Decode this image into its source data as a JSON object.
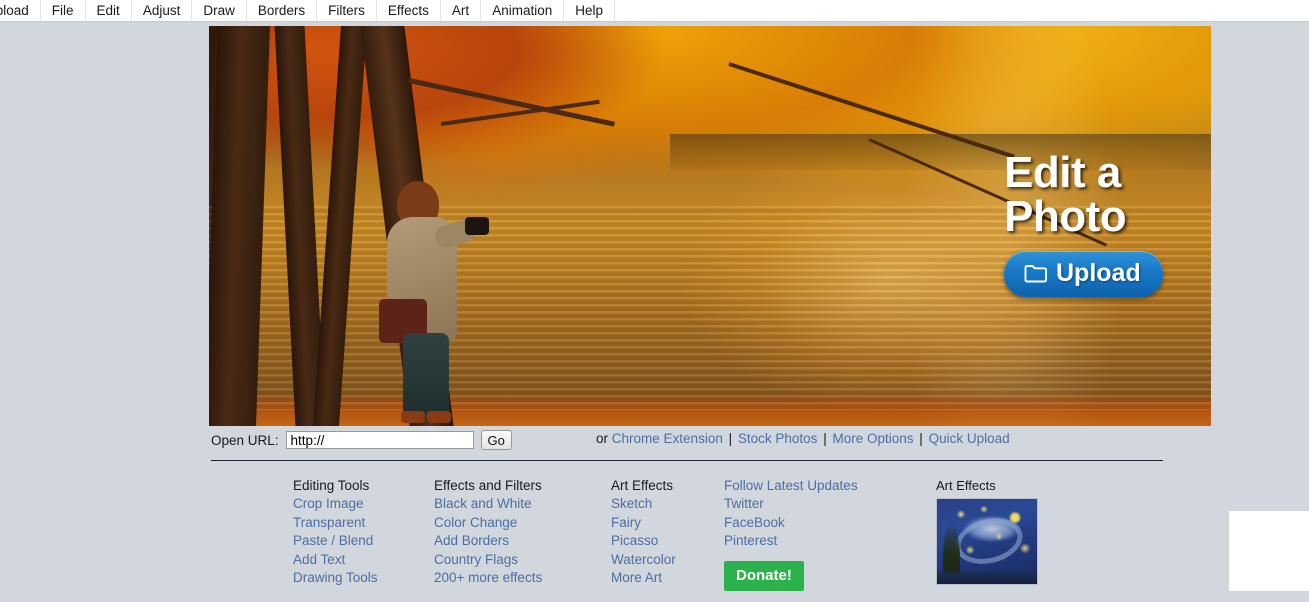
{
  "menubar": {
    "items": [
      {
        "label": "Upload"
      },
      {
        "label": "File"
      },
      {
        "label": "Edit"
      },
      {
        "label": "Adjust"
      },
      {
        "label": "Draw"
      },
      {
        "label": "Borders"
      },
      {
        "label": "Filters"
      },
      {
        "label": "Effects"
      },
      {
        "label": "Art"
      },
      {
        "label": "Animation"
      },
      {
        "label": "Help"
      }
    ]
  },
  "hero": {
    "headline_line1": "Edit a",
    "headline_line2": "Photo",
    "upload_label": "Upload",
    "upload_icon": "folder-icon",
    "photo_description": "Woman photographing an autumn lakeside"
  },
  "urlbar": {
    "label": "Open URL:",
    "input_value": "http://",
    "input_placeholder": "http://",
    "go_label": "Go",
    "or_text": "or",
    "links": [
      {
        "label": "Chrome Extension"
      },
      {
        "label": "Stock Photos"
      },
      {
        "label": "More Options"
      },
      {
        "label": "Quick Upload"
      }
    ],
    "separator": "|"
  },
  "footer": {
    "columns": [
      {
        "heading": "Editing Tools",
        "heading_is_link": false,
        "links": [
          {
            "label": "Crop Image"
          },
          {
            "label": "Transparent"
          },
          {
            "label": "Paste / Blend"
          },
          {
            "label": "Add Text"
          },
          {
            "label": "Drawing Tools"
          }
        ]
      },
      {
        "heading": "Effects and Filters",
        "heading_is_link": false,
        "links": [
          {
            "label": "Black and White"
          },
          {
            "label": "Color Change"
          },
          {
            "label": "Add Borders"
          },
          {
            "label": "Country Flags"
          },
          {
            "label": "200+ more effects"
          }
        ]
      },
      {
        "heading": "Art Effects",
        "heading_is_link": false,
        "links": [
          {
            "label": "Sketch"
          },
          {
            "label": "Fairy"
          },
          {
            "label": "Picasso"
          },
          {
            "label": "Watercolor"
          },
          {
            "label": "More Art"
          }
        ]
      },
      {
        "heading": "Follow Latest Updates",
        "heading_is_link": true,
        "links": [
          {
            "label": "Twitter"
          },
          {
            "label": "FaceBook"
          },
          {
            "label": "Pinterest"
          }
        ]
      }
    ],
    "donate_label": "Donate!"
  },
  "art_effects_panel": {
    "title": "Art Effects",
    "thumbnail_description": "Starry Night painting thumbnail"
  },
  "colors": {
    "page_background": "#d2d7dd",
    "link": "#4a6fa5",
    "upload_button": "#1778c6",
    "donate_button": "#2bb24c",
    "divider": "#1b2430",
    "menubar_background": "#ffffff"
  }
}
